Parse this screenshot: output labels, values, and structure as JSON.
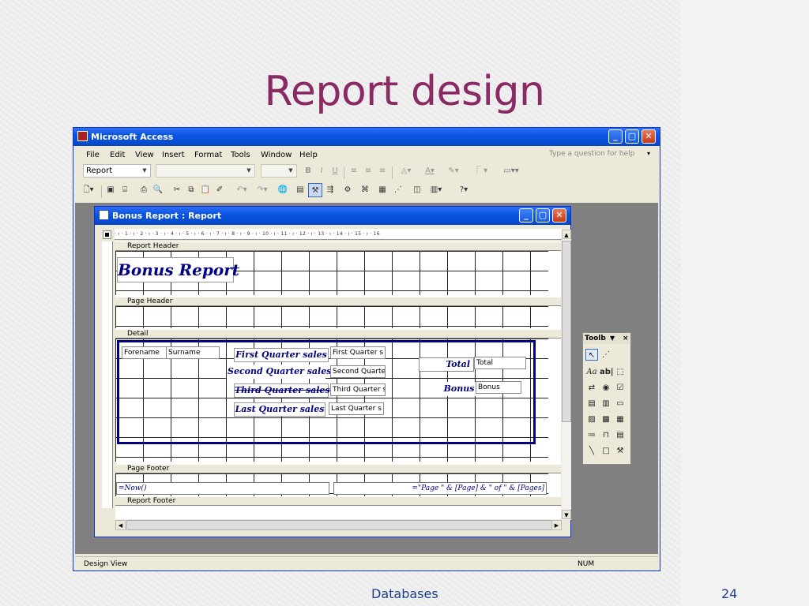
{
  "slide": {
    "title": "Report design",
    "footer_left": "Databases",
    "footer_right": "24"
  },
  "app": {
    "title": "Microsoft Access",
    "help_placeholder": "Type a question for help",
    "menu": [
      "File",
      "Edit",
      "View",
      "Insert",
      "Format",
      "Tools",
      "Window",
      "Help"
    ],
    "object_box": "Report",
    "font_bold": "B",
    "font_italic": "I",
    "font_underline": "U"
  },
  "report_window": {
    "title": "Bonus Report : Report",
    "ruler": "· ı · 1 · ı · 2 · ı · 3 · ı · 4 · ı · 5 · ı · 6 · ı · 7 · ı · 8 · ı · 9 · ı · 10 · ı · 11 · ı · 12 · ı · 13 · ı · 14 · ı · 15 · ı · 16",
    "sections": {
      "report_header": "Report Header",
      "page_header": "Page Header",
      "detail": "Detail",
      "page_footer": "Page Footer",
      "report_footer": "Report Footer"
    },
    "report_title": "Bonus Report",
    "fields": {
      "forename": "Forename",
      "surname": "Surname",
      "q1_label": "First Quarter sales",
      "q1_box": "First Quarter s",
      "q2_label": "Second Quarter sales",
      "q2_box": "Second Quarte",
      "q3_label": "Third Quarter sales",
      "q3_box": "Third Quarter s",
      "q4_label": "Last Quarter sales",
      "q4_box": "Last Quarter s",
      "total_label": "Total",
      "total_box": "Total",
      "bonus_label": "Bonus",
      "bonus_box": "Bonus"
    },
    "page_footer": {
      "now": "=Now()",
      "pages": "=\"Page \" & [Page] & \" of \" & [Pages]"
    }
  },
  "toolbox": {
    "title": "Toolb",
    "text_box": "ab|",
    "label": "Aa"
  },
  "status": {
    "left": "Design View",
    "num": "NUM"
  }
}
